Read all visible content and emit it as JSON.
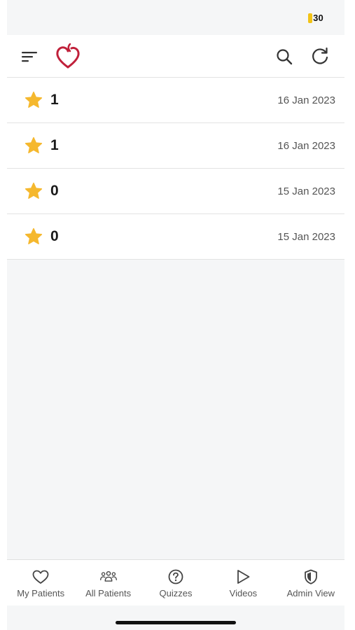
{
  "status_bar": {
    "battery_level": "30"
  },
  "header": {
    "menu_icon": "menu-icon",
    "logo_icon": "heart-logo-icon",
    "search_icon": "search-icon",
    "refresh_icon": "refresh-icon",
    "logo_color": "#c0203a"
  },
  "records": [
    {
      "score": "1",
      "date": "16 Jan 2023"
    },
    {
      "score": "1",
      "date": "16 Jan 2023"
    },
    {
      "score": "0",
      "date": "15 Jan 2023"
    },
    {
      "score": "0",
      "date": "15 Jan 2023"
    }
  ],
  "star_color": "#f5b82e",
  "tabs": [
    {
      "label": "My Patients",
      "icon": "heart-icon"
    },
    {
      "label": "All Patients",
      "icon": "people-icon"
    },
    {
      "label": "Quizzes",
      "icon": "question-circle-icon"
    },
    {
      "label": "Videos",
      "icon": "play-icon"
    },
    {
      "label": "Admin View",
      "icon": "shield-icon"
    }
  ]
}
